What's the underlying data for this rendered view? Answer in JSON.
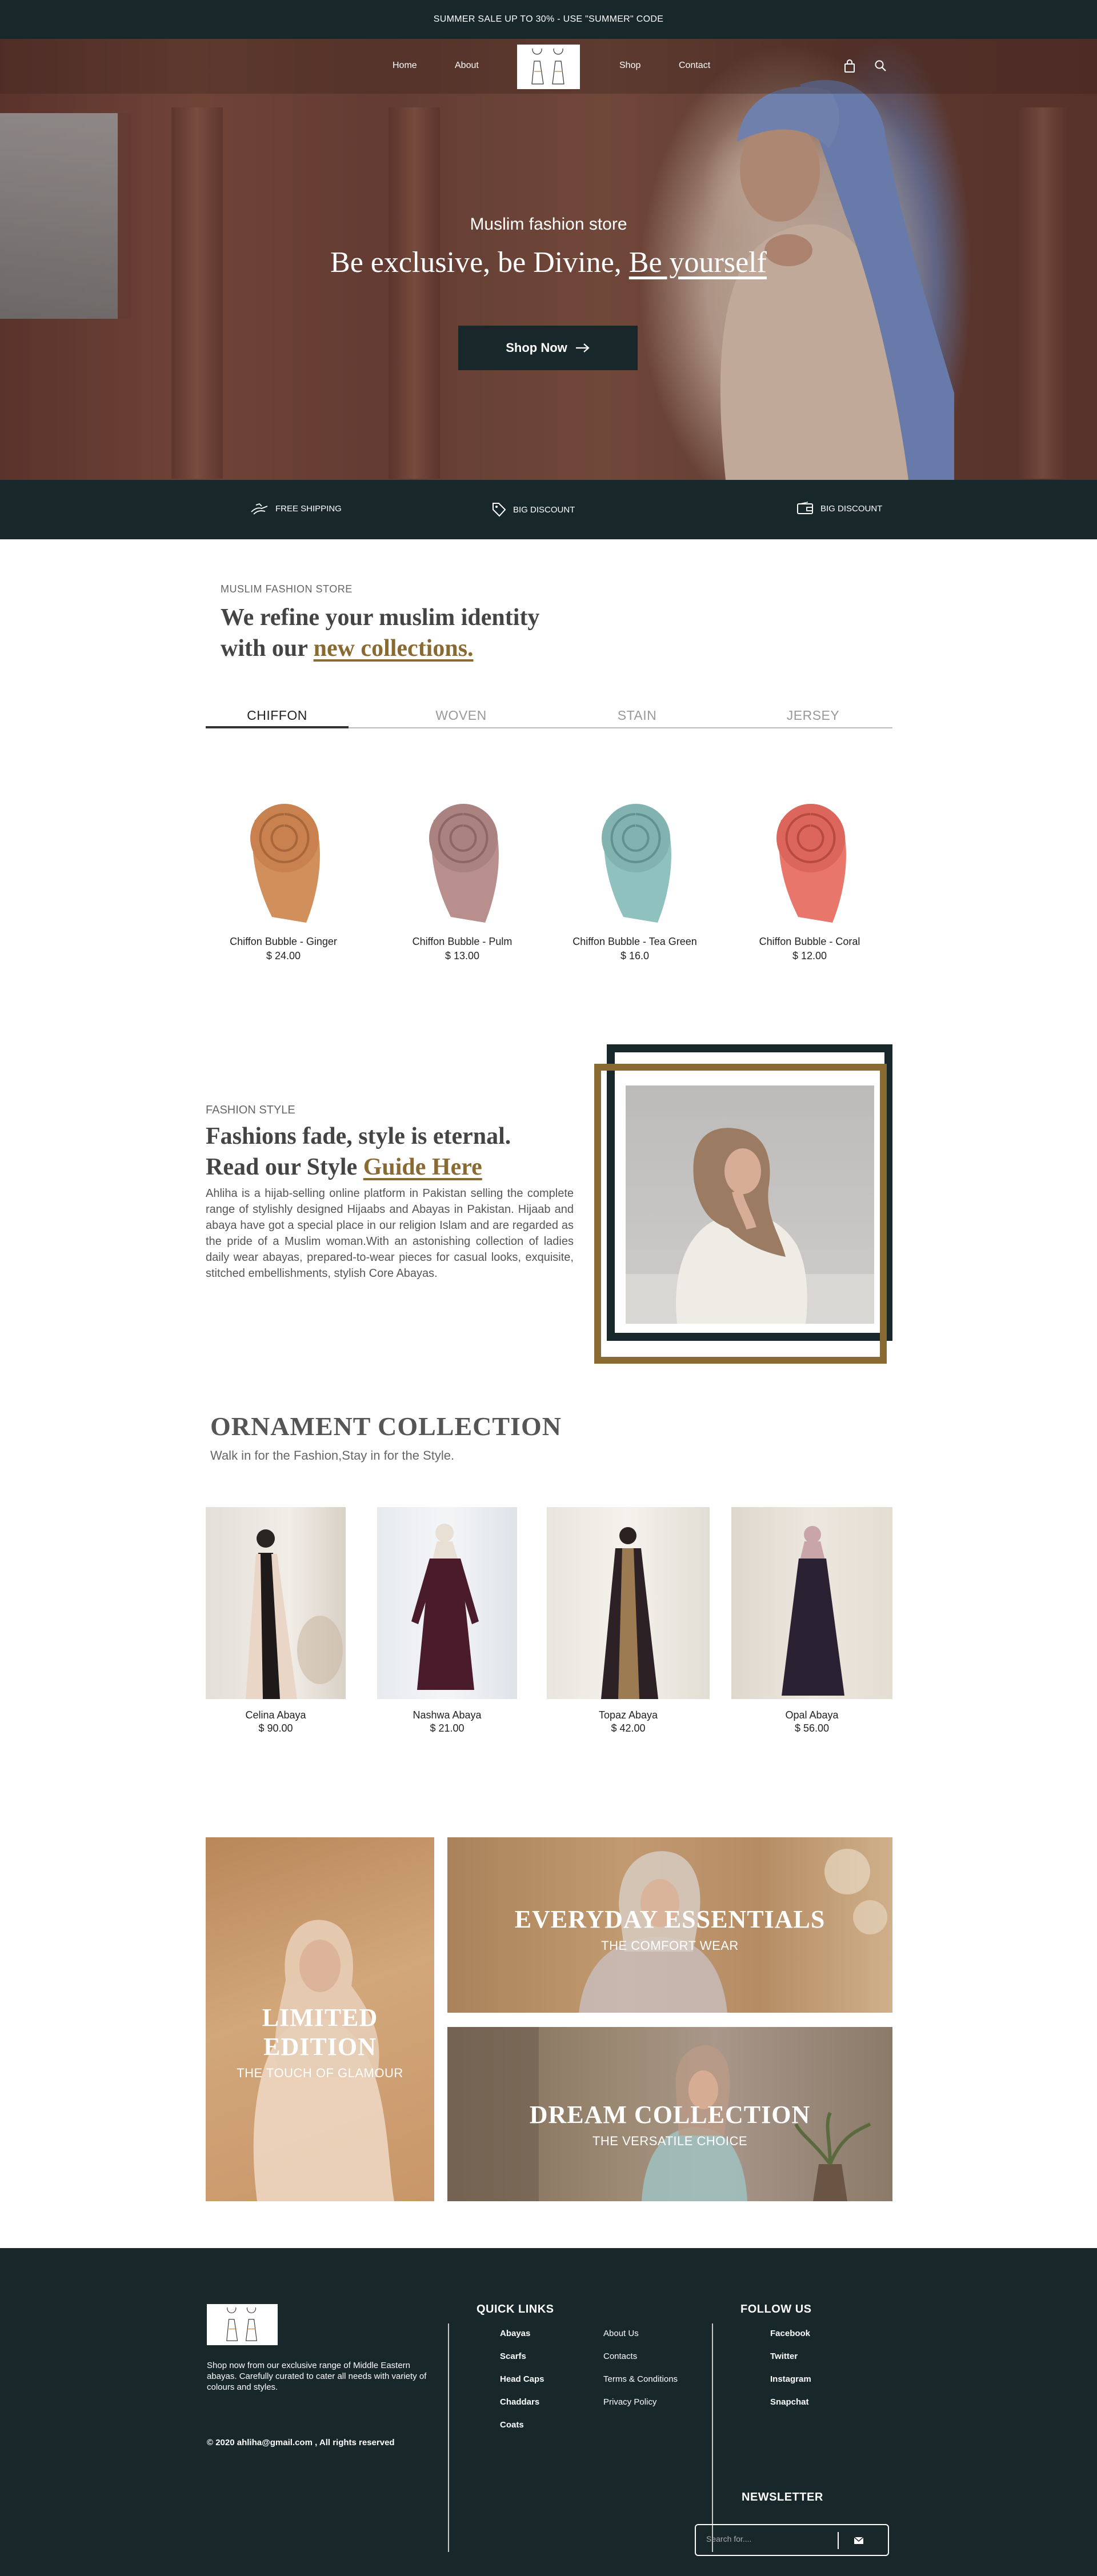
{
  "announcement": "SUMMER SALE UP TO 30% - USE \"SUMMER\" CODE",
  "nav": {
    "home": "Home",
    "about": "About",
    "shop": "Shop",
    "contact": "Contact",
    "icons": [
      "bag-icon",
      "search-icon"
    ]
  },
  "hero": {
    "subtitle": "Muslim fashion store",
    "title_part1": "Be exclusive, be Divine, ",
    "title_part2": "Be yourself",
    "cta": "Shop Now"
  },
  "features": [
    {
      "icon": "shipping-icon",
      "label": "FREE SHIPPING"
    },
    {
      "icon": "tag-icon",
      "label": "BIG DISCOUNT"
    },
    {
      "icon": "wallet-icon",
      "label": "BIG DISCOUNT"
    }
  ],
  "intro": {
    "kicker": "MUSLIM FASHION STORE",
    "title_line1": "We refine your muslim identity",
    "title_line2_prefix": "with our ",
    "title_line2_link": "new collections."
  },
  "tabs": [
    "CHIFFON",
    "WOVEN",
    "STAIN",
    "JERSEY"
  ],
  "products": [
    {
      "name": "Chiffon Bubble - Ginger",
      "price": "$ 24.00",
      "color": "#d18f5c"
    },
    {
      "name": "Chiffon Bubble - Pulm",
      "price": "$ 13.00",
      "color": "#b88f8c"
    },
    {
      "name": "Chiffon Bubble - Tea Green",
      "price": "$ 16.0",
      "color": "#8fc1bf"
    },
    {
      "name": "Chiffon Bubble - Coral",
      "price": "$ 12.00",
      "color": "#e8766b"
    }
  ],
  "fashion_style": {
    "kicker": "FASHION STYLE",
    "title_line1": "Fashions fade, style is eternal.",
    "title_line2_prefix": "Read our Style ",
    "title_line2_link": "Guide Here",
    "body": "Ahliha is a hijab-selling online platform in Pakistan selling the complete range of stylishly designed Hijaabs and Abayas in Pakistan. Hijaab and abaya have got a special place in our religion Islam and are regarded as the pride of a Muslim woman.With an astonishing collection of ladies daily wear abayas, prepared-to-wear pieces for casual looks, exquisite, stitched embellishments, stylish Core Abayas."
  },
  "ornament": {
    "title": "ORNAMENT COLLECTION",
    "subtitle": "Walk in for the Fashion,Stay in for the Style.",
    "items": [
      {
        "name": "Celina Abaya",
        "price": "$ 90.00"
      },
      {
        "name": "Nashwa Abaya",
        "price": "$ 21.00"
      },
      {
        "name": "Topaz Abaya",
        "price": "$ 42.00"
      },
      {
        "name": "Opal Abaya",
        "price": "$ 56.00"
      }
    ]
  },
  "collections": {
    "limited": {
      "title": "LIMITED EDITION",
      "subtitle": "THE TOUCH OF GLAMOUR"
    },
    "everyday": {
      "title": "EVERYDAY ESSENTIALS",
      "subtitle": "THE COMFORT WEAR"
    },
    "dream": {
      "title": "DREAM COLLECTION",
      "subtitle": "THE VERSATILE CHOICE"
    }
  },
  "footer": {
    "description": "Shop now from our exclusive range of Middle Eastern abayas. Carefully curated to cater all needs with variety of colours and styles.",
    "copyright": "© 2020 ahliha@gmail.com , All rights reserved",
    "quick_links_title": "QUICK LINKS",
    "quick_links_col1": [
      "Abayas",
      "Scarfs",
      "Head Caps",
      "Chaddars",
      "Coats"
    ],
    "quick_links_col2": [
      "About Us",
      "Contacts",
      "Terms & Conditions",
      "Privacy Policy"
    ],
    "follow_title": "FOLLOW  US",
    "social": [
      "Facebook",
      "Twitter",
      "Instagram",
      "Snapchat"
    ],
    "newsletter_title": "NEWSLETTER",
    "newsletter_placeholder": "Search for...."
  },
  "colors": {
    "dark": "#17272a",
    "gold": "#8a6a33"
  }
}
